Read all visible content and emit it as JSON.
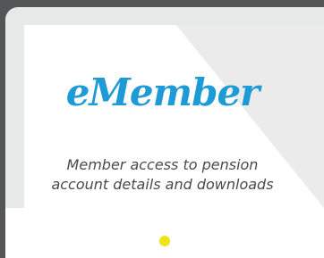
{
  "brand": {
    "name": "eMember",
    "color": "#1e9bd7"
  },
  "tagline": {
    "line1": "Member access to pension",
    "line2": "account details and downloads"
  },
  "device": {
    "frame_color": "#545557",
    "bezel_color": "#e7e8e8",
    "indicator_color": "#f0e31a",
    "indicator_icon": "home-indicator-dot"
  }
}
